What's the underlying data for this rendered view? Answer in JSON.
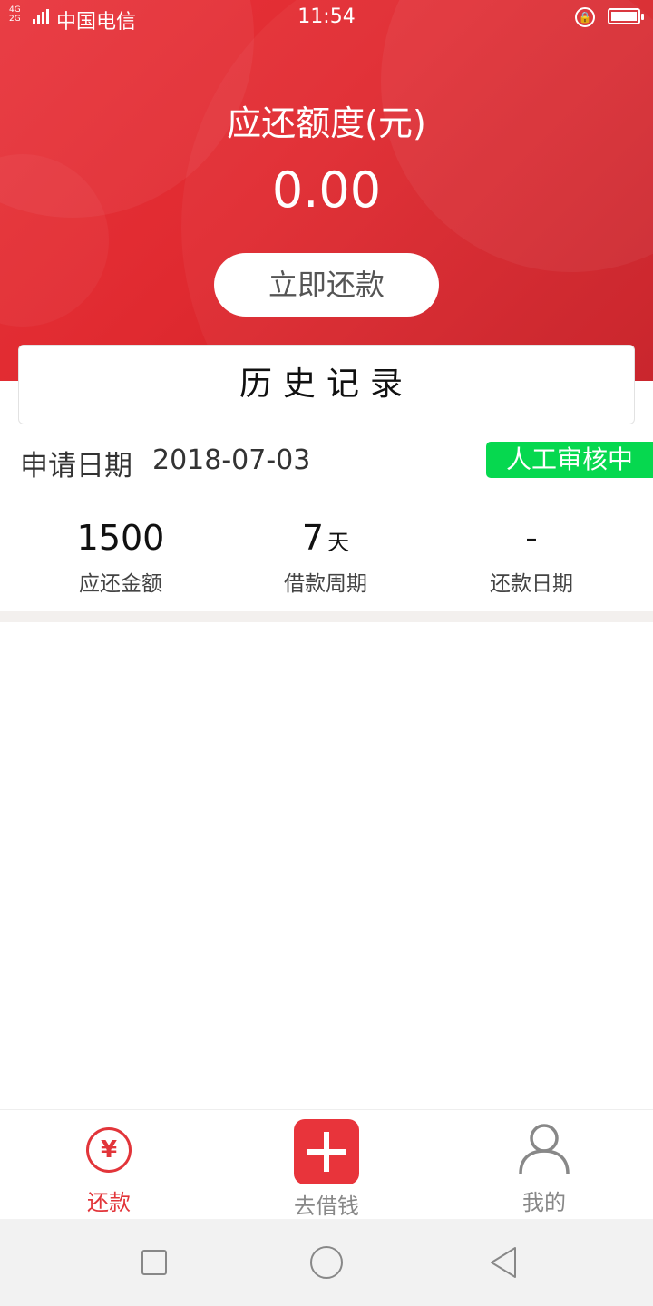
{
  "status_bar": {
    "network": "4G 2G",
    "carrier": "中国电信",
    "time": "11:54"
  },
  "header": {
    "title": "应还额度(元)",
    "amount": "0.00",
    "repay_button": "立即还款"
  },
  "history_label": "历史记录",
  "record": {
    "apply_label": "申请日期",
    "apply_date": "2018-07-03",
    "status": "人工审核中",
    "stats": [
      {
        "value": "1500",
        "unit": "",
        "label": "应还金额"
      },
      {
        "value": "7",
        "unit": "天",
        "label": "借款周期"
      },
      {
        "value": "-",
        "unit": "",
        "label": "还款日期"
      }
    ]
  },
  "tabbar": {
    "tabs": [
      {
        "label": "还款",
        "icon": "yen-circle-icon",
        "active": true
      },
      {
        "label": "去借钱",
        "icon": "plus-icon",
        "active": false
      },
      {
        "label": "我的",
        "icon": "person-icon",
        "active": false
      }
    ]
  },
  "colors": {
    "brand_red": "#e2353a",
    "status_green": "#06d84f"
  }
}
